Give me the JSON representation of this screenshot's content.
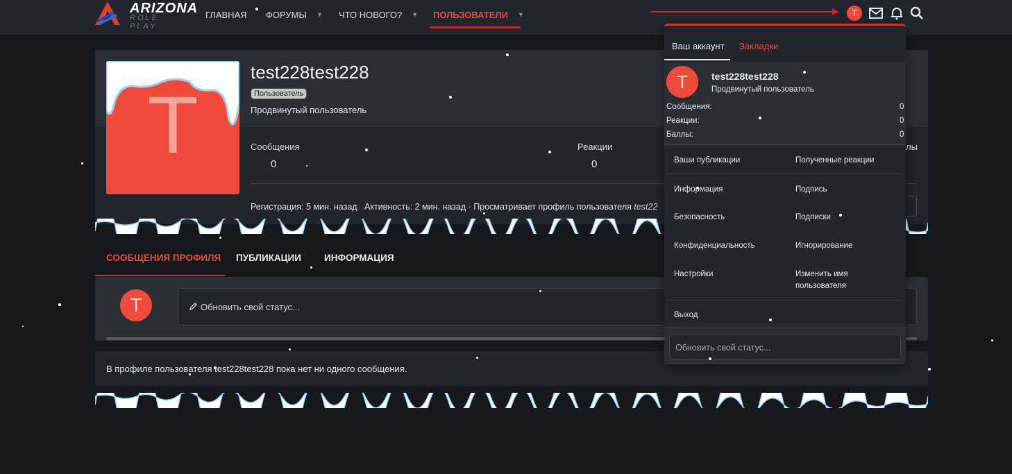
{
  "logo": {
    "name": "ARIZONA",
    "sub": "ROLE PLAY"
  },
  "nav": [
    {
      "label": "ГЛАВНАЯ"
    },
    {
      "label": "ФОРУМЫ"
    },
    {
      "label": "ЧТО НОВОГО?"
    },
    {
      "label": "ПОЛЬЗОВАТЕЛИ"
    }
  ],
  "header": {
    "avatar_letter": "T"
  },
  "profile": {
    "avatar_letter": "T",
    "username": "test228test228",
    "badge": "Пользователь",
    "title": "Продвинутый пользователь",
    "stats": [
      {
        "label": "Сообщения",
        "value": "0"
      },
      {
        "label": "Реакции",
        "value": "0"
      },
      {
        "label": "лы",
        "value": ""
      }
    ],
    "meta": {
      "reg_label": "Регистрация:",
      "reg_value": "5 мин. назад",
      "act_label": "Активность:",
      "act_value": "2 мин. назад · Просматривает профиль пользователя",
      "act_target": "test22"
    }
  },
  "tabs": [
    {
      "label": "СООБЩЕНИЯ ПРОФИЛЯ"
    },
    {
      "label": "ПУБЛИКАЦИИ"
    },
    {
      "label": "ИНФОРМАЦИЯ"
    }
  ],
  "status": {
    "placeholder": "Обновить свой статус...",
    "avatar_letter": "T"
  },
  "empty_message": "В профиле пользователя test228test228 пока нет ни одного сообщения.",
  "dropdown": {
    "tabs": [
      {
        "label": "Ваш аккаунт"
      },
      {
        "label": "Закладки"
      }
    ],
    "avatar_letter": "T",
    "username": "test228test228",
    "title": "Продвинутый пользователь",
    "stats": [
      {
        "label": "Сообщения:",
        "value": "0"
      },
      {
        "label": "Реакции:",
        "value": "0"
      },
      {
        "label": "Баллы:",
        "value": "0"
      }
    ],
    "links": {
      "publications": "Ваши публикации",
      "reactions": "Полученные реакции",
      "info": "Информация",
      "signature": "Подпись",
      "security": "Безопасность",
      "following": "Подписки",
      "privacy": "Конфиденциальность",
      "ignoring": "Игнорирование",
      "settings": "Настройки",
      "rename": "Изменить имя пользователя",
      "logout": "Выход"
    },
    "status_placeholder": "Обновить свой статус..."
  },
  "colors": {
    "accent": "#e64a40",
    "avatar": "#f04a3d",
    "bg": "#17181d",
    "panel": "#2b2e36"
  }
}
